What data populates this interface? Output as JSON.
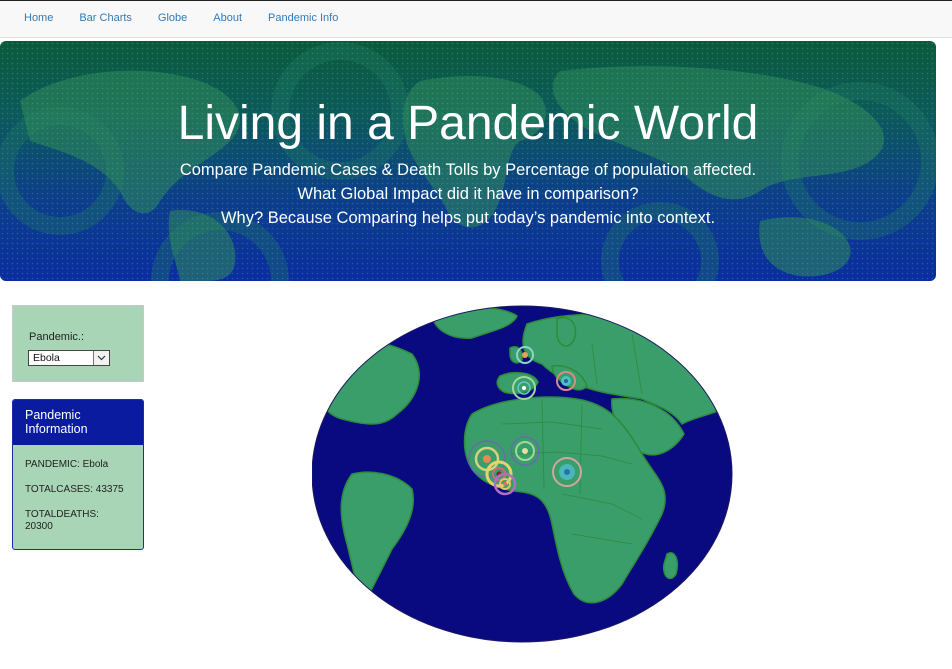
{
  "nav": {
    "items": [
      "Home",
      "Bar Charts",
      "Globe",
      "About",
      "Pandemic Info"
    ]
  },
  "hero": {
    "title": "Living in a Pandemic World",
    "lines": [
      "Compare Pandemic Cases & Death Tolls by Percentage of population affected.",
      "What Global Impact did it have in comparison?",
      "Why? Because Comparing helps put today’s pandemic into context."
    ]
  },
  "selector": {
    "label": "Pandemic.:",
    "selected": "Ebola"
  },
  "info": {
    "heading": "Pandemic Information",
    "pandemic": "PANDEMIC: Ebola",
    "total_cases": "TOTALCASES: 43375",
    "total_deaths": "TOTALDEATHS: 20300"
  },
  "colors": {
    "ocean": "#0a0a80",
    "land": "#3a9e6a",
    "border": "#2e8b3a",
    "panel": "#a8d5b5",
    "panel_header": "#0a1ba0",
    "link": "#337ab7"
  }
}
